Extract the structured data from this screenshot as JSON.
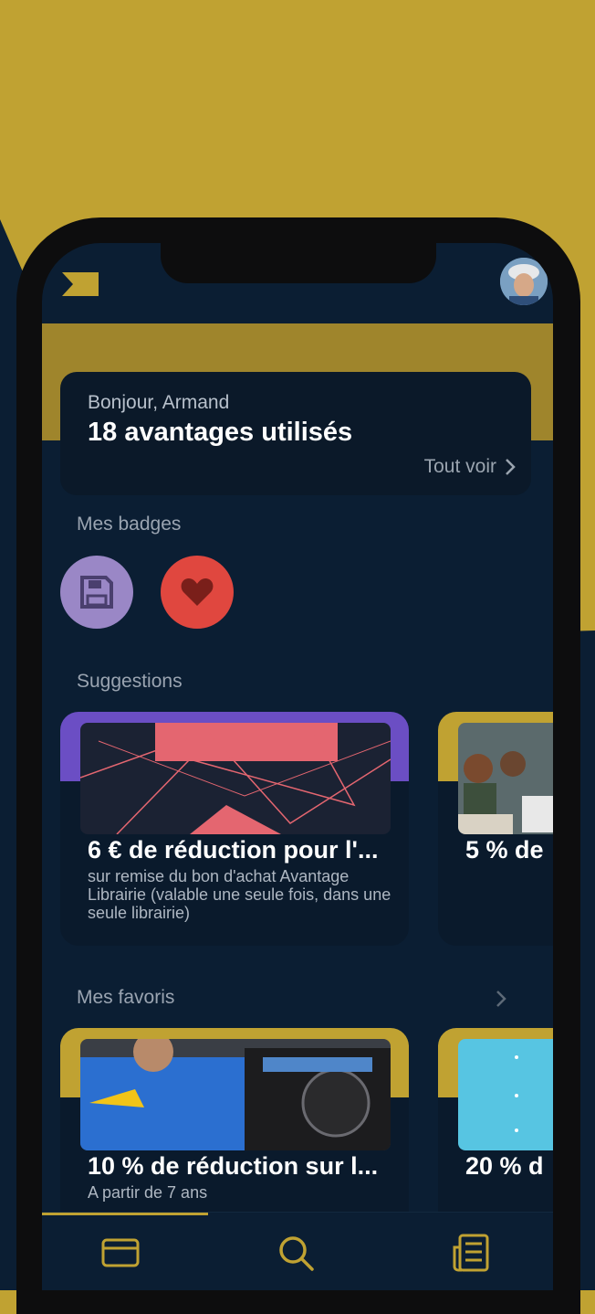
{
  "colors": {
    "gold": "#c0a232",
    "navy": "#0b1e33",
    "card": "#0a1a2c",
    "purple": "#9a87c6",
    "red": "#e0473f"
  },
  "header": {
    "logo": "brand-logo",
    "avatar": "user-avatar"
  },
  "greeting": {
    "hello": "Bonjour, Armand",
    "count": "18 avantages utilisés",
    "see_all": "Tout voir"
  },
  "badges": {
    "title": "Mes badges",
    "items": [
      {
        "icon": "floppy-disk-icon",
        "color": "#9a87c6"
      },
      {
        "icon": "heart-icon",
        "color": "#e0473f"
      }
    ]
  },
  "suggestions": {
    "title": "Suggestions",
    "items": [
      {
        "title": "6 € de réduction pour l'...",
        "subtitle": "sur remise du bon d'achat Avantage Librairie (valable une seule fois, dans une seule librairie)"
      },
      {
        "title": "5 % de"
      }
    ]
  },
  "favorites": {
    "title": "Mes favoris",
    "items": [
      {
        "title": "10 % de réduction sur l...",
        "subtitle": "A partir de 7 ans"
      },
      {
        "title": "20 % d"
      }
    ]
  },
  "tabbar": {
    "items": [
      {
        "icon": "card-icon"
      },
      {
        "icon": "search-icon"
      },
      {
        "icon": "newspaper-icon"
      }
    ]
  }
}
